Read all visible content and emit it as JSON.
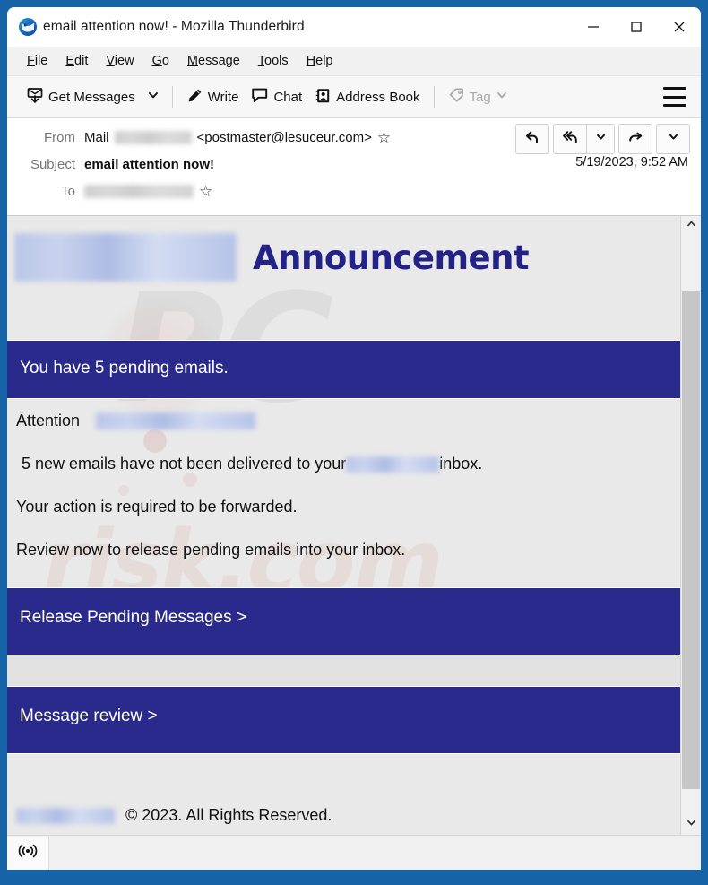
{
  "window": {
    "title": "email attention now! - Mozilla Thunderbird",
    "app_icon": "thunderbird-icon",
    "controls": {
      "minimize": "minimize-icon",
      "maximize": "maximize-icon",
      "close": "close-icon"
    }
  },
  "menubar": {
    "items": [
      {
        "label": "File",
        "accesskey": "F"
      },
      {
        "label": "Edit",
        "accesskey": "E"
      },
      {
        "label": "View",
        "accesskey": "V"
      },
      {
        "label": "Go",
        "accesskey": "G"
      },
      {
        "label": "Message",
        "accesskey": "M"
      },
      {
        "label": "Tools",
        "accesskey": "T"
      },
      {
        "label": "Help",
        "accesskey": "H"
      }
    ]
  },
  "toolbar": {
    "get_messages": "Get Messages",
    "get_messages_icon": "download-mail-icon",
    "get_messages_caret": "chevron-down-icon",
    "write": "Write",
    "write_icon": "pencil-icon",
    "chat": "Chat",
    "chat_icon": "speech-bubble-icon",
    "address_book": "Address Book",
    "address_book_icon": "contact-card-icon",
    "tag": "Tag",
    "tag_icon": "tag-icon",
    "tag_caret": "chevron-down-icon",
    "tag_disabled": true,
    "app_menu_icon": "hamburger-menu-icon"
  },
  "message_header": {
    "from_label": "From",
    "from_name": "Mail",
    "from_redacted": "████████",
    "from_address": "<postmaster@lesuceur.com>",
    "from_star_icon": "star-outline-icon",
    "subject_label": "Subject",
    "subject_value": "email attention now!",
    "date": "5/19/2023, 9:52 AM",
    "to_label": "To",
    "to_redacted": "██████████",
    "to_star_icon": "star-outline-icon",
    "actions": {
      "reply": "reply-icon",
      "reply_all": "reply-all-icon",
      "reply_all_caret": "chevron-down-icon",
      "forward": "forward-icon",
      "more_caret": "chevron-down-icon"
    }
  },
  "email": {
    "logo_redacted": "",
    "heading": "Announcement",
    "banner_pending": "You have 5 pending emails.",
    "attention_label": "Attention",
    "attention_redacted": "",
    "line_delivered_pre": " 5 new emails have not been delivered to your ",
    "line_delivered_post": " inbox.",
    "line_action": "Your action is required to be forwarded.",
    "line_review": "Review now to release pending emails into your inbox.",
    "cta_release": "Release Pending Messages >",
    "cta_review": "Message review >",
    "footer_redacted": "",
    "footer_copyright": "© 2023. All Rights Reserved.",
    "watermark_main": "PC",
    "watermark_sub": "risk.com"
  },
  "scrollbar": {
    "up_icon": "chevron-up-icon",
    "down_icon": "chevron-down-icon",
    "thumb": "scrollbar-thumb"
  },
  "statusbar": {
    "online_icon": "broadcast-online-icon"
  },
  "colors": {
    "window_border": "#1763a8",
    "banner_blue": "#2a2a8c",
    "heading_blue": "#222287",
    "body_bg": "#e9e9e9"
  }
}
